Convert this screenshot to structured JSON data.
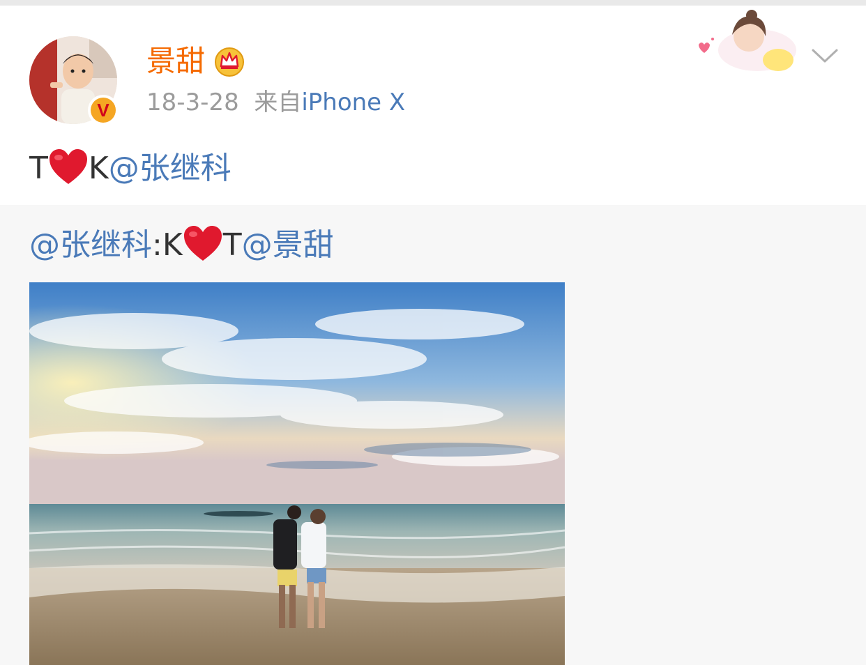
{
  "post": {
    "author": "景甜",
    "time": "18-3-28",
    "source_prefix": "来自",
    "device": "iPhone X",
    "text_before": "T",
    "text_middle": "K",
    "mention": "@张继科"
  },
  "repost": {
    "mention": "@张继科",
    "separator": ":K",
    "text_after_heart": "T",
    "mention2": "@景甜"
  },
  "icons": {
    "verify_badge": "V",
    "crown": "crown-icon",
    "heart": "heart-icon",
    "dropdown": "chevron-down-icon"
  },
  "colors": {
    "author": "#f56a00",
    "mention": "#4a7ab8",
    "meta": "#9b9b9b",
    "heart": "#e0192e"
  }
}
